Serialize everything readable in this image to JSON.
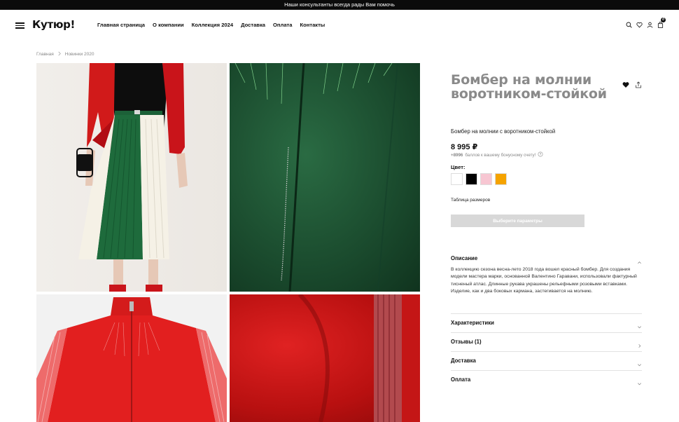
{
  "topbar": {
    "text": "Наши консультанты всегда рады Вам помочь"
  },
  "header": {
    "logo": "Кутюр!",
    "nav": [
      "Главная страница",
      "О компании",
      "Коллекция 2024",
      "Доставка",
      "Оплата",
      "Контакты"
    ],
    "icons": [
      "search-icon",
      "heart-icon",
      "user-icon",
      "bag-icon"
    ],
    "cart_count": "0"
  },
  "breadcrumb": {
    "home": "Главная",
    "separator": ">",
    "current": "Новинки 2020"
  },
  "product": {
    "title": "Бомбер на молнии воротником-стойкой",
    "subtitle": "Бомбер на молнии с воротником-стойкой",
    "price": "8 995 ₽",
    "bonus_amount": "+8996",
    "bonus_text": "баллов к вашему бонусному счету!",
    "color_label": "Цвет:",
    "colors": [
      "#ffffff",
      "#000000",
      "#f7c6d2",
      "#f5a300"
    ],
    "size_table": "Таблица размеров",
    "cta": "Выберите параметры"
  },
  "accordion": {
    "description_title": "Описание",
    "description_text": "В коллекцию сезона весна-лето 2018 года вошел красный бомбер. Для создания модели мастера марки, основанной Валентино Гаравани, использовали фактурный тисненый атлас. Длинные рукава украшены рельефными розовыми вставками. Изделие, как и два боковых кармана, застегивается на молнию.",
    "items": [
      "Характеристики",
      "Отзывы (1)",
      "Доставка",
      "Оплата"
    ]
  }
}
